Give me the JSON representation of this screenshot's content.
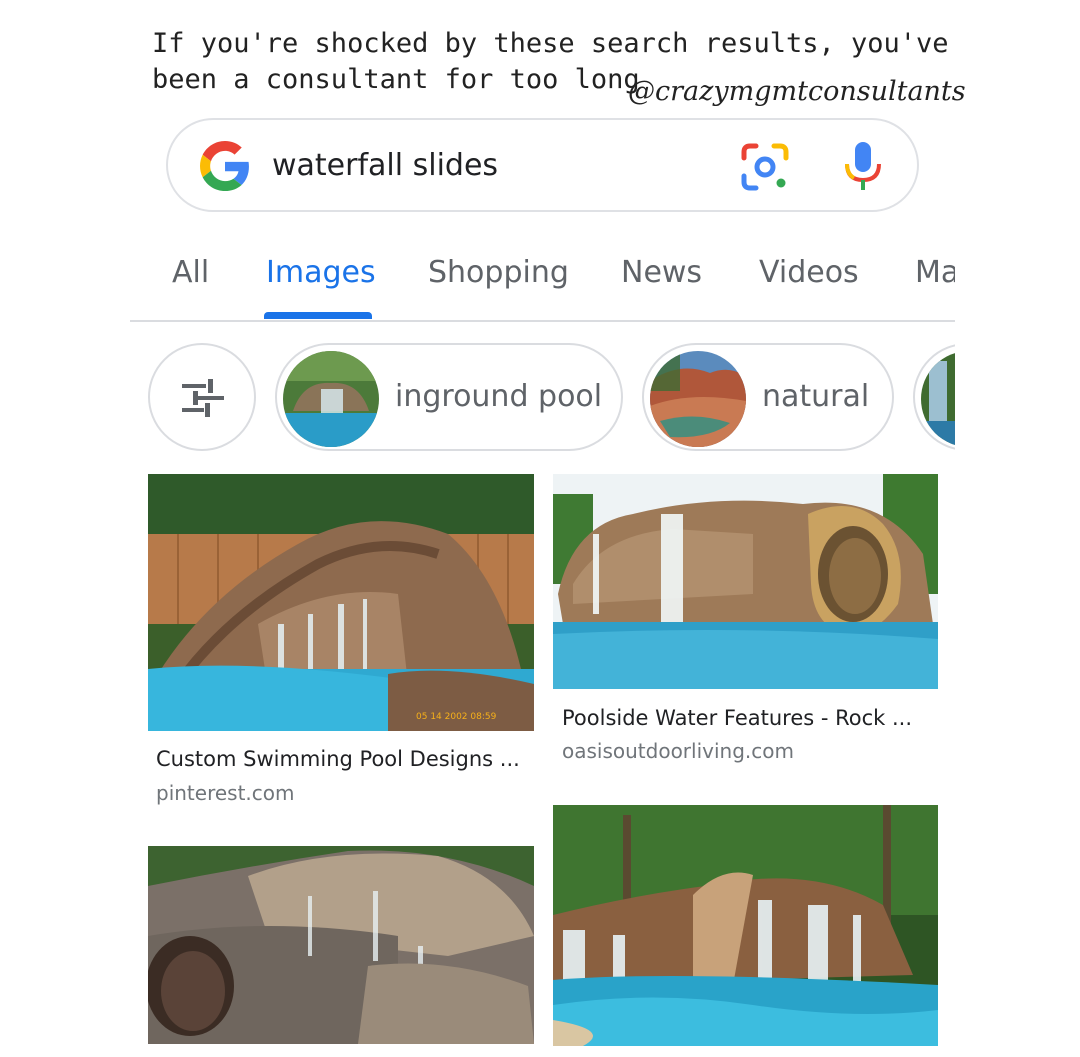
{
  "caption": {
    "text": "If you're shocked by these search results, you've been a consultant for too long",
    "handle": "@crazymgmtconsultants"
  },
  "search": {
    "query": "waterfall slides",
    "icons": [
      "google-logo",
      "lens-camera-icon",
      "microphone-icon"
    ]
  },
  "tabs": [
    {
      "label": "All",
      "active": false
    },
    {
      "label": "Images",
      "active": true
    },
    {
      "label": "Shopping",
      "active": false
    },
    {
      "label": "News",
      "active": false
    },
    {
      "label": "Videos",
      "active": false
    },
    {
      "label": "Ma",
      "active": false
    }
  ],
  "chips": [
    {
      "label": "",
      "icon": "filter-sliders-icon"
    },
    {
      "label": "inground pool"
    },
    {
      "label": "natural"
    },
    {
      "label": ""
    }
  ],
  "results": [
    {
      "title": "Custom Swimming Pool Designs ...",
      "source": "pinterest.com",
      "photo_stamp": "05 14 2002  08:59"
    },
    {
      "title": "Poolside Water Features - Rock ...",
      "source": "oasisoutdoorliving.com"
    },
    {
      "title": "",
      "source": ""
    },
    {
      "title": "",
      "source": ""
    }
  ],
  "colors": {
    "accent": "#1a73e8",
    "google_blue": "#4285F4",
    "google_red": "#EA4335",
    "google_yellow": "#FBBC05",
    "google_green": "#34A853",
    "pool_water": "#2fa9d1"
  }
}
